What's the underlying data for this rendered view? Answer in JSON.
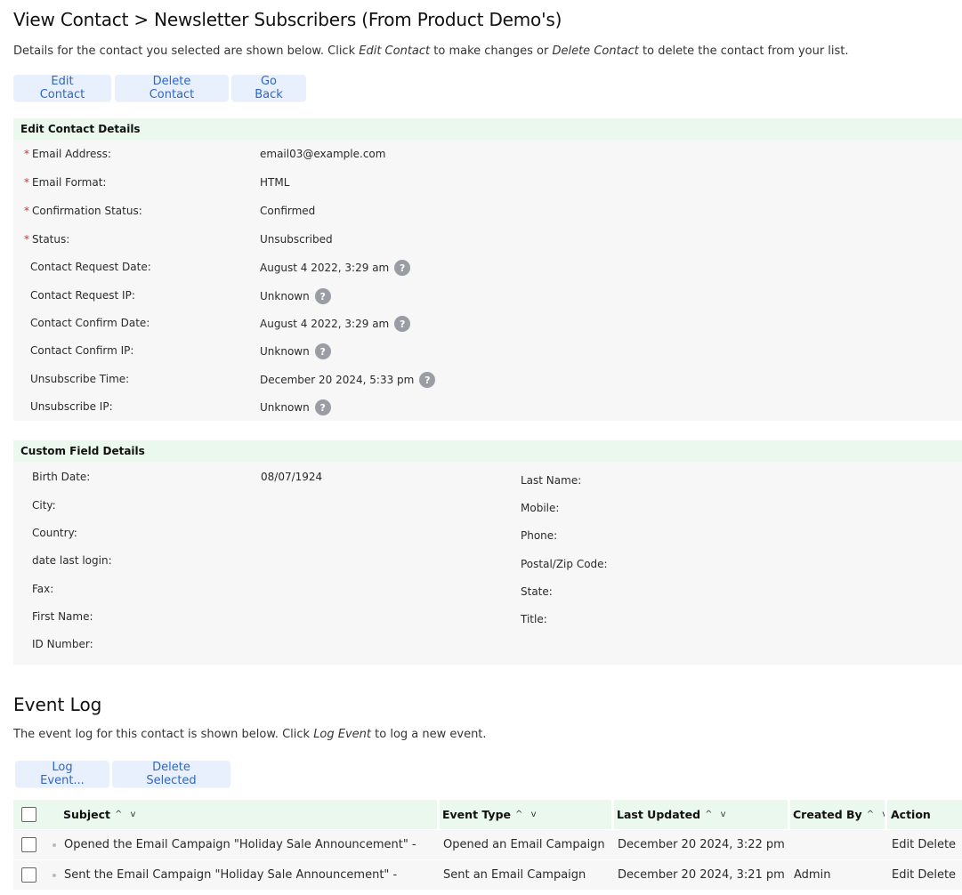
{
  "page": {
    "title": "View Contact > Newsletter Subscribers (From Product Demo's)",
    "intro": {
      "part1": "Details for the contact you selected are shown below. Click ",
      "edit_link": "Edit Contact",
      "part2": " to make changes or ",
      "delete_link": "Delete Contact",
      "part3": " to delete the contact from your list."
    },
    "buttons": {
      "edit": "Edit Contact",
      "delete": "Delete Contact",
      "back": "Go Back"
    }
  },
  "contact_details": {
    "heading": "Edit Contact Details",
    "required_mark": "*",
    "help_glyph": "?",
    "fields": [
      {
        "label": "Email Address:",
        "value": "email03@example.com",
        "required": true,
        "help": false
      },
      {
        "label": "Email Format:",
        "value": "HTML",
        "required": true,
        "help": false
      },
      {
        "label": "Confirmation Status:",
        "value": "Confirmed",
        "required": true,
        "help": false
      },
      {
        "label": "Status:",
        "value": "Unsubscribed",
        "required": true,
        "help": false
      },
      {
        "label": "Contact Request Date:",
        "value": "August 4 2022, 3:29 am",
        "required": false,
        "help": true
      },
      {
        "label": "Contact Request IP:",
        "value": "Unknown",
        "required": false,
        "help": true
      },
      {
        "label": "Contact Confirm Date:",
        "value": "August 4 2022, 3:29 am",
        "required": false,
        "help": true
      },
      {
        "label": "Contact Confirm IP:",
        "value": "Unknown",
        "required": false,
        "help": true
      },
      {
        "label": "Unsubscribe Time:",
        "value": "December 20 2024, 5:33 pm",
        "required": false,
        "help": true
      },
      {
        "label": "Unsubscribe IP:",
        "value": "Unknown",
        "required": false,
        "help": true
      }
    ]
  },
  "custom_fields": {
    "heading": "Custom Field Details",
    "left": [
      {
        "label": "Birth Date:",
        "value": "08/07/1924"
      },
      {
        "label": "City:",
        "value": ""
      },
      {
        "label": "Country:",
        "value": ""
      },
      {
        "label": "date last login:",
        "value": ""
      },
      {
        "label": "Fax:",
        "value": ""
      },
      {
        "label": "First Name:",
        "value": ""
      },
      {
        "label": "ID Number:",
        "value": ""
      }
    ],
    "right": [
      {
        "label": "Last Name:",
        "value": ""
      },
      {
        "label": "Mobile:",
        "value": ""
      },
      {
        "label": "Phone:",
        "value": ""
      },
      {
        "label": "Postal/Zip Code:",
        "value": ""
      },
      {
        "label": "State:",
        "value": ""
      },
      {
        "label": "Title:",
        "value": ""
      }
    ]
  },
  "event_log": {
    "heading": "Event Log",
    "intro": {
      "part1": "The event log for this contact is shown below. Click ",
      "link": "Log Event",
      "part2": " to log a new event."
    },
    "buttons": {
      "log": "Log Event...",
      "delete_selected": "Delete Selected"
    },
    "sort_glyph": "^ v",
    "columns": {
      "subject": "Subject",
      "event_type": "Event Type",
      "last_updated": "Last Updated",
      "created_by": "Created By",
      "action": "Action"
    },
    "rows": [
      {
        "subject": "Opened the Email Campaign \"Holiday Sale Announcement\" -",
        "event_type": "Opened an Email Campaign",
        "last_updated": "December 20 2024, 3:22 pm",
        "created_by": "",
        "edit": "Edit",
        "delete": "Delete"
      },
      {
        "subject": "Sent the Email Campaign \"Holiday Sale Announcement\" -",
        "event_type": "Sent an Email Campaign",
        "last_updated": "December 20 2024, 3:21 pm",
        "created_by": "Admin",
        "edit": "Edit",
        "delete": "Delete"
      }
    ]
  }
}
